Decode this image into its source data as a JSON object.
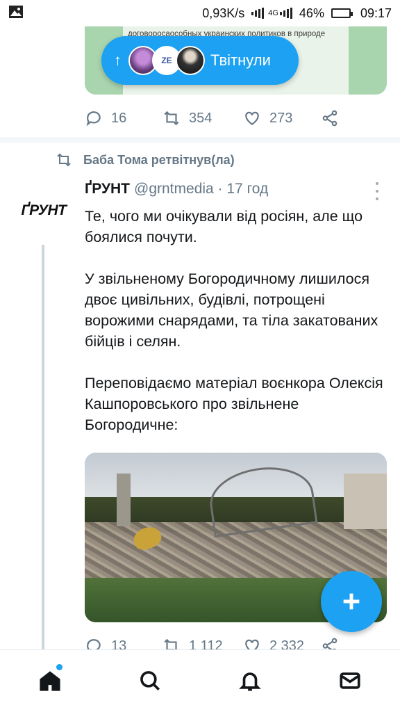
{
  "status_bar": {
    "speed": "0,93K/s",
    "network": "4G",
    "battery": "46%",
    "battery_level": 0.46,
    "time": "09:17",
    "gallery_icon": "image-icon"
  },
  "previous_tweet": {
    "media_text": "договоросаособных украинских политиков в природе\n                                 атских,\n                           ует – хватит\n                               ные должны",
    "counts": {
      "replies": "16",
      "retweets": "354",
      "likes": "273"
    }
  },
  "new_tweets_pill": {
    "label": "Твітнули",
    "avatar_2_text": "ZE"
  },
  "retweet_context": {
    "text": "Баба Тома ретвітнув(ла)"
  },
  "tweet": {
    "avatar_text": "ҐРУНТ",
    "name": "ҐРУНТ",
    "handle_time": "@grntmedia · 17 год",
    "text_p1": "Те, чого ми очікували від росіян, але що боялися почути.",
    "text_p2": "У звільненому Богородичному лишилося двоє цивільних, будівлі, потрощені ворожими снарядами, та тіла закатованих бійців і селян.",
    "text_p3": "Переповідаємо матеріал воєнкора Олексія Кашпоровського про звільнене Богородичне:",
    "counts": {
      "replies": "13",
      "retweets": "1 112",
      "likes": "2 332"
    }
  },
  "colors": {
    "accent": "#1da1f2",
    "secondary_text": "#657786",
    "divider": "#e6ecf0"
  }
}
